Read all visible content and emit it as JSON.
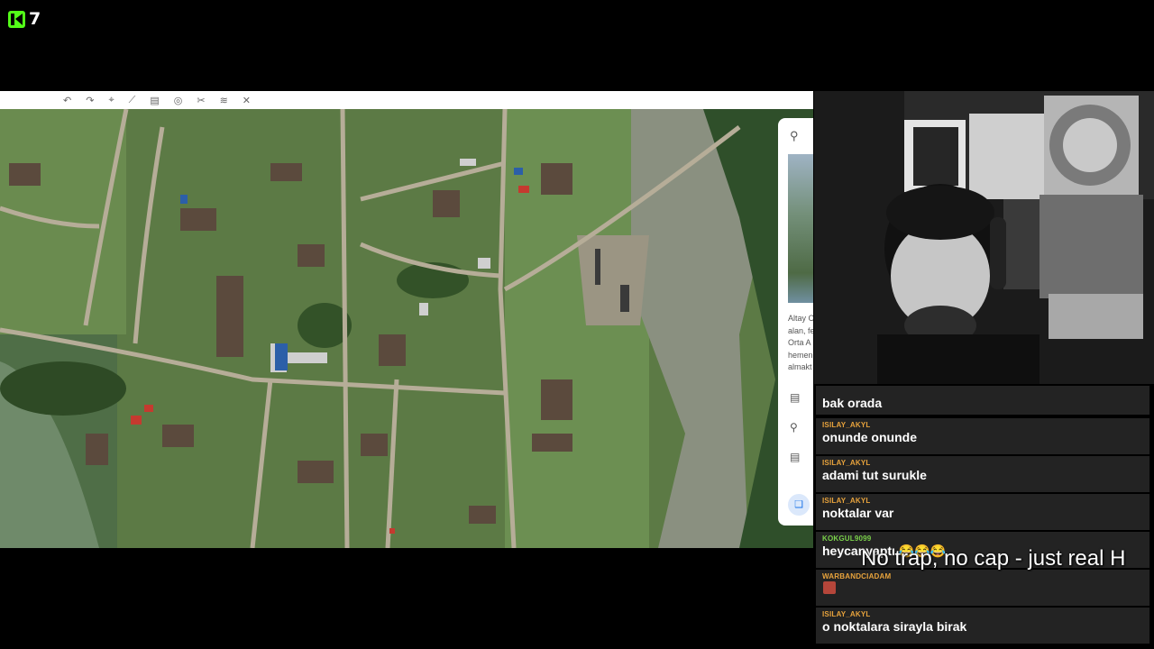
{
  "brand": {
    "logo_icon": "kick-logo-icon",
    "viewer_count": "7",
    "accent": "#53fc18"
  },
  "map_panel": {
    "snippet_lines": [
      "Altay C",
      "alan, fe",
      "Orta A",
      "hemen",
      "almakt"
    ]
  },
  "chat": {
    "messages": [
      {
        "user": "",
        "text": "bak orada",
        "user_color": "#e8a33c"
      },
      {
        "user": "ISILAY_AKYL",
        "text": "onunde onunde",
        "user_color": "#e8a33c"
      },
      {
        "user": "ISILAY_AKYL",
        "text": "adami tut surukle",
        "user_color": "#e8a33c"
      },
      {
        "user": "ISILAY_AKYL",
        "text": "noktalar var",
        "user_color": "#e8a33c"
      },
      {
        "user": "KOKGUL9099",
        "text": "heycanyaptı 😂😂😂",
        "user_color": "#7ad14a"
      },
      {
        "user": "WARBANDCIADAM",
        "text": "",
        "user_color": "#e8a33c"
      },
      {
        "user": "ISILAY_AKYL",
        "text": "o noktalara sirayla birak",
        "user_color": "#e8a33c"
      }
    ]
  },
  "caption": "No trap, no cap - just real H"
}
